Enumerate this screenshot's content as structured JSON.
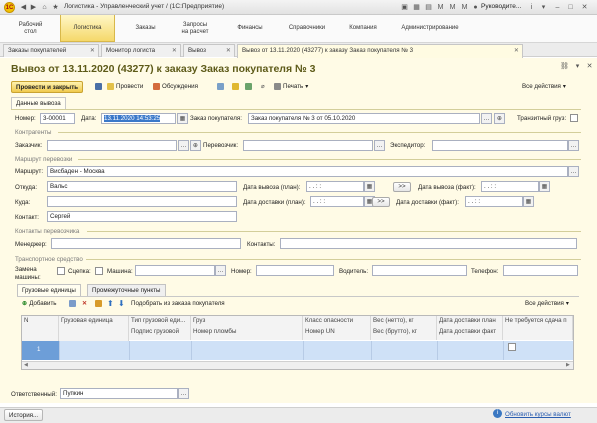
{
  "window": {
    "title": "Логистика - Управленческий учет / (1С:Предприятие)",
    "user": "Руководите..."
  },
  "sections": [
    {
      "label": "Рабочий\nстол"
    },
    {
      "label": "Логистика"
    },
    {
      "label": "Заказы"
    },
    {
      "label": "Запросы\nна расчет"
    },
    {
      "label": "Финансы"
    },
    {
      "label": "Справочники"
    },
    {
      "label": "Компания"
    },
    {
      "label": "Администрирование"
    }
  ],
  "tabs": [
    {
      "label": "Заказы покупателей"
    },
    {
      "label": "Монитор логиста"
    },
    {
      "label": "Вывоз"
    },
    {
      "label": "Вывоз от 13.11.2020 (43277) к заказу  Заказ покупателя № 3"
    }
  ],
  "form": {
    "title": "Вывоз от 13.11.2020 (43277) к заказу  Заказ покупателя № 3",
    "toolbar": {
      "post_close": "Провести и закрыть",
      "post": "Провести",
      "discussions": "Обсуждения",
      "print": "Печать",
      "all_actions": "Все действия"
    },
    "tab_label": "Данные вывоза",
    "number_label": "Номер:",
    "number_value": "3-00001",
    "date_label": "Дата:",
    "date_value": "13.11.2020 14:53:25",
    "order_label": "Заказ покупателя:",
    "order_value": "Заказ покупателя № 3 от 05.10.2020",
    "transit_label": "Транзитный груз:",
    "counterparties_group": "Контрагенты",
    "customer_label": "Заказчик:",
    "carrier_label": "Перевозчик:",
    "forwarder_label": "Экспедитор:",
    "route_group": "Маршрут перевозки",
    "route_label": "Маршрут:",
    "route_value": "Висбаден - Москва",
    "from_label": "Откуда:",
    "from_value": "Вальс",
    "to_label": "Куда:",
    "contact_label": "Контакт:",
    "contact_value": "Сергей",
    "export_plan_label": "Дата вывоза (план):",
    "export_plan_value": ". .   :  :",
    "export_fact_label": "Дата вывоза (факт):",
    "export_fact_value": ". .   :  :",
    "delivery_plan_label": "Дата доставки (план):",
    "delivery_plan_value": ". .   :  :",
    "delivery_fact_label": "Дата доставки (факт):",
    "delivery_fact_value": ". .   :  :",
    "arrow": ">>",
    "carrier_contacts_group": "Контакты перевозчика",
    "manager_label": "Менеджер:",
    "contacts_label": "Контакты:",
    "vehicle_group": "Транспортное средство",
    "vehicle_replace_label": "Замена\nмашины:",
    "coupling_label": "Сцепка:",
    "truck_label": "Машина:",
    "plate_label": "Номер:",
    "driver_label": "Водитель:",
    "phone_label": "Телефон:",
    "cargo_tabs": [
      "Грузовые единицы",
      "Промежуточные пункты"
    ],
    "cargo_toolbar": {
      "add": "Добавить",
      "fill_from_order": "Подобрать из заказа покупателя",
      "all_actions": "Все действия"
    },
    "table_headers_row1": [
      "N",
      "Грузовая единица",
      "Тип грузовой еди...",
      "Груз",
      "Класс опасности",
      "Вес (нетто), кг",
      "Дата доставки план",
      "Не требуется сдача п"
    ],
    "table_headers_row2": [
      "",
      "",
      "Подпис грузовой",
      "Номер пломбы",
      "Номер UN",
      "Вес (брутто), кг",
      "Дата доставки факт",
      ""
    ],
    "table_row": {
      "n": "1"
    },
    "responsible_label": "Ответственный:",
    "responsible_value": "Пупкин"
  },
  "statusbar": {
    "history": "История...",
    "update_rates": "Обновить курсы валют"
  }
}
